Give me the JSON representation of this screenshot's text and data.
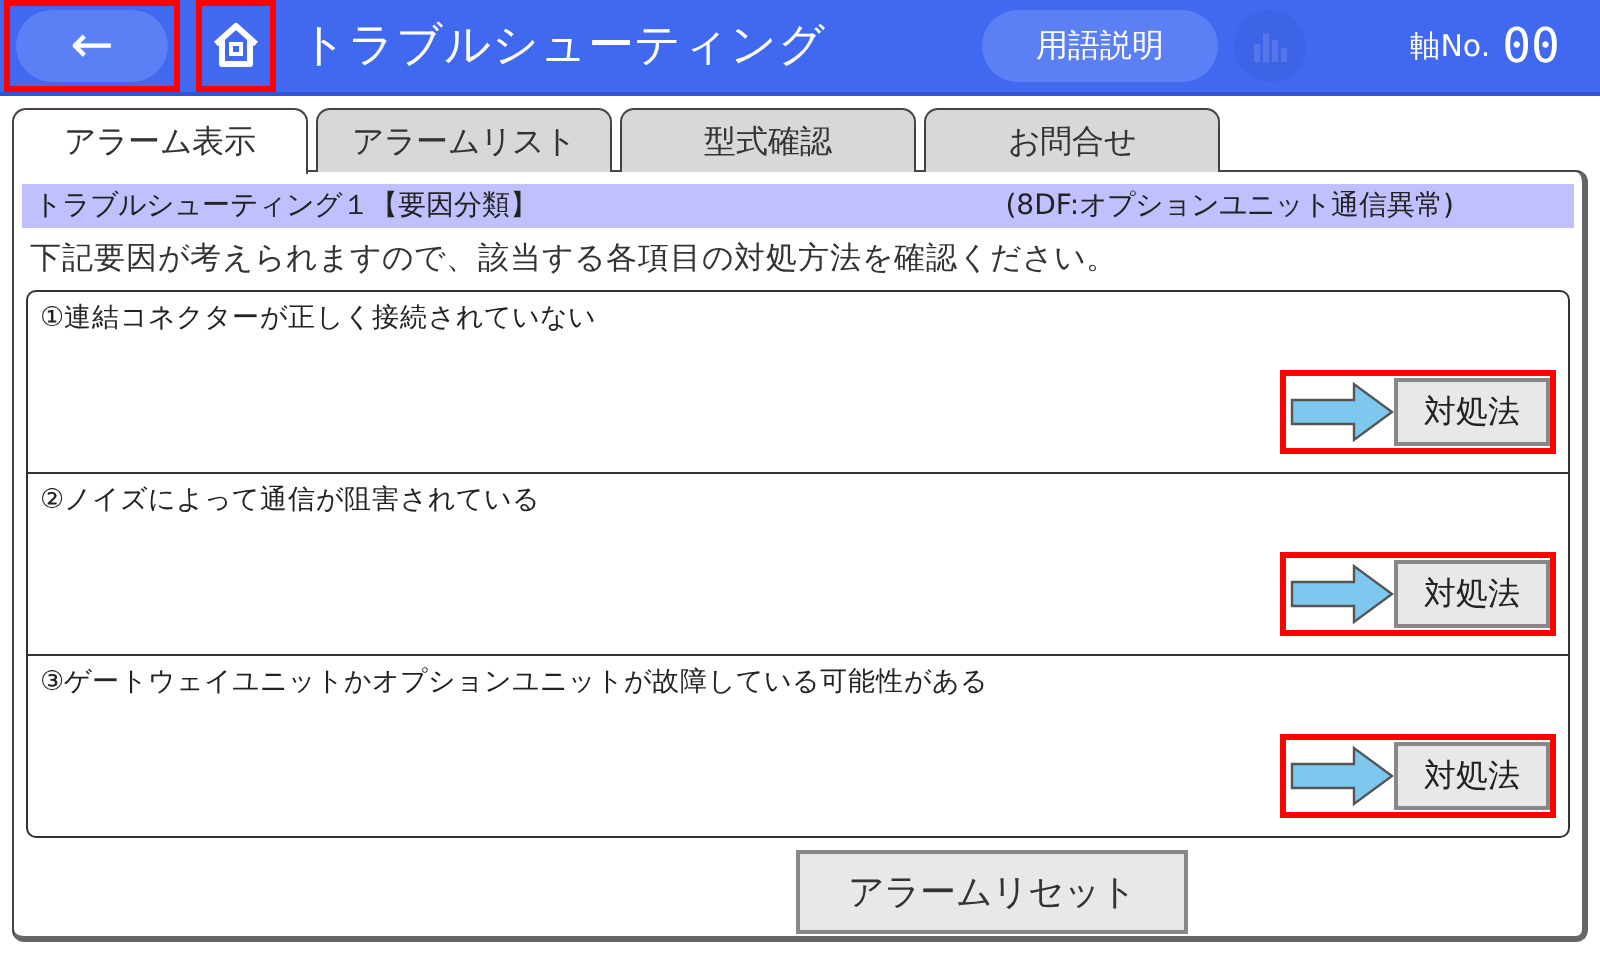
{
  "header": {
    "back": {
      "label": "←",
      "highlighted": true
    },
    "home": {
      "highlighted": true
    },
    "title": "トラブルシューティング",
    "glossary_button": "用語説明",
    "chart_button": {
      "disabled": true
    },
    "axis_label": "軸No.",
    "axis_value": "00"
  },
  "tabs": [
    {
      "label": "アラーム表示",
      "selected": true
    },
    {
      "label": "アラームリスト",
      "selected": false
    },
    {
      "label": "型式確認",
      "selected": false
    },
    {
      "label": "お問合せ",
      "selected": false
    }
  ],
  "section": {
    "title": "トラブルシューティング１【要因分類】",
    "code": "(8DF:オプションユニット通信異常)"
  },
  "instruction": "下記要因が考えられますので、該当する各項目の対処方法を確認ください。",
  "causes": [
    {
      "text": "①連結コネクターが正しく接続されていない",
      "button": "対処法",
      "highlighted": true
    },
    {
      "text": "②ノイズによって通信が阻害されている",
      "button": "対処法",
      "highlighted": true
    },
    {
      "text": "③ゲートウェイユニットかオプションユニットが故障している可能性がある",
      "button": "対処法",
      "highlighted": true
    }
  ],
  "reset_button": "アラームリセット"
}
